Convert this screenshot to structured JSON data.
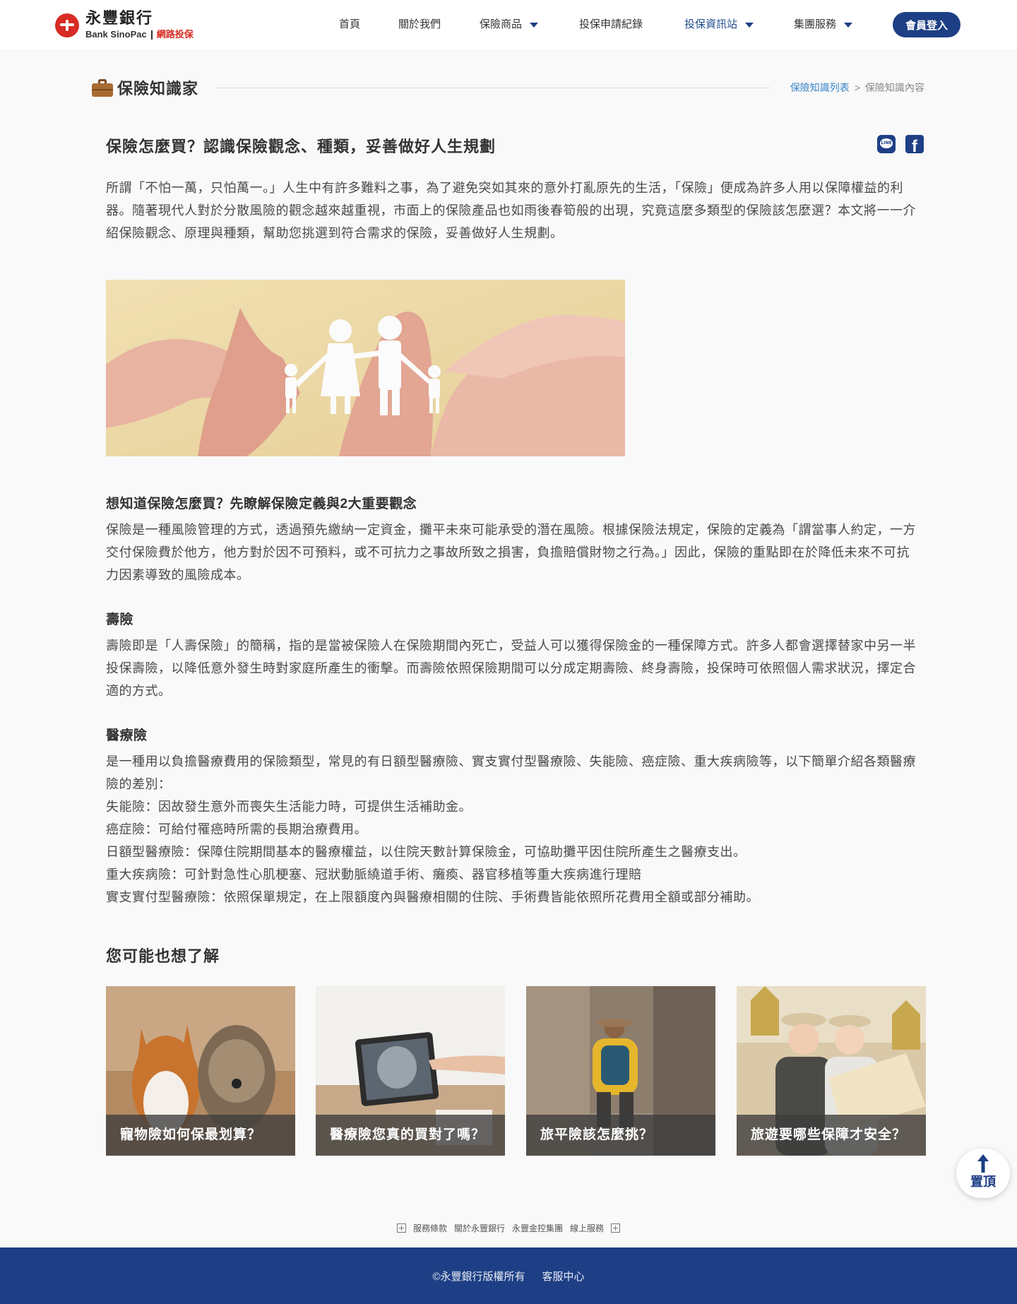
{
  "header": {
    "logo_zh": "永豐銀行",
    "logo_en": "Bank SinoPac",
    "logo_tag": "網路投保",
    "nav": [
      {
        "label": "首頁"
      },
      {
        "label": "關於我們"
      },
      {
        "label": "保險商品"
      },
      {
        "label": "投保申請紀錄"
      },
      {
        "label": "投保資訊站"
      },
      {
        "label": "集團服務"
      }
    ],
    "login": "會員登入"
  },
  "section": {
    "title": "保險知識家",
    "breadcrumb_link": "保險知識列表",
    "breadcrumb_sep": ">",
    "breadcrumb_current": "保險知識內容"
  },
  "article": {
    "title": "保險怎麼買？認識保險觀念、種類，妥善做好人生規劃",
    "share_line": "LINE",
    "intro": "所謂「不怕一萬，只怕萬一。」人生中有許多難料之事，為了避免突如其來的意外打亂原先的生活，「保險」便成為許多人用以保障權益的利器。隨著現代人對於分散風險的觀念越來越重視，市面上的保險產品也如雨後春筍般的出現，究竟這麼多類型的保險該怎麼選？本文將一一介紹保險觀念、原理與種類，幫助您挑選到符合需求的保險，妥善做好人生規劃。",
    "h_concept": "想知道保險怎麼買？先瞭解保險定義與2大重要觀念",
    "p_concept": "保險是一種風險管理的方式，透過預先繳納一定資金，攤平未來可能承受的潛在風險。根據保險法規定，保險的定義為「謂當事人約定，一方交付保險費於他方，他方對於因不可預料，或不可抗力之事故所致之損害，負擔賠償財物之行為。」因此，保險的重點即在於降低未來不可抗力因素導致的風險成本。",
    "h_life": "壽險",
    "p_life": "壽險即是「人壽保險」的簡稱，指的是當被保險人在保險期間內死亡，受益人可以獲得保險金的一種保障方式。許多人都會選擇替家中另一半投保壽險，以降低意外發生時對家庭所產生的衝擊。而壽險依照保險期間可以分成定期壽險、終身壽險，投保時可依照個人需求狀況，擇定合適的方式。",
    "h_medical": "醫療險",
    "p_medical": "是一種用以負擔醫療費用的保險類型，常見的有日額型醫療險、實支實付型醫療險、失能險、癌症險、重大疾病險等，以下簡單介紹各類醫療險的差別：",
    "medical_list": [
      "失能險：因故發生意外而喪失生活能力時，可提供生活補助金。",
      "癌症險：可給付罹癌時所需的長期治療費用。",
      "日額型醫療險：保障住院期間基本的醫療權益，以住院天數計算保險金，可協助攤平因住院所產生之醫療支出。",
      "重大疾病險：可針對急性心肌梗塞、冠狀動脈繞道手術、癱瘓、器官移植等重大疾病進行理賠",
      "實支實付型醫療險：依照保單規定，在上限額度內與醫療相關的住院、手術費皆能依照所花費用全額或部分補助。"
    ]
  },
  "related": {
    "title": "您可能也想了解",
    "cards": [
      {
        "label": "寵物險如何保最划算？"
      },
      {
        "label": "醫療險您真的買對了嗎？"
      },
      {
        "label": "旅平險該怎麼挑？"
      },
      {
        "label": "旅遊要哪些保障才安全？"
      }
    ]
  },
  "totop": "置頂",
  "footer": {
    "links": [
      "服務條款",
      "關於永豐銀行",
      "永豐金控集團",
      "線上服務"
    ],
    "copyright": "©永豐銀行版權所有",
    "service": "客服中心"
  },
  "colors": {
    "brand_navy": "#1e3f85",
    "brand_red": "#d72b23",
    "link_blue": "#3a86c8"
  }
}
